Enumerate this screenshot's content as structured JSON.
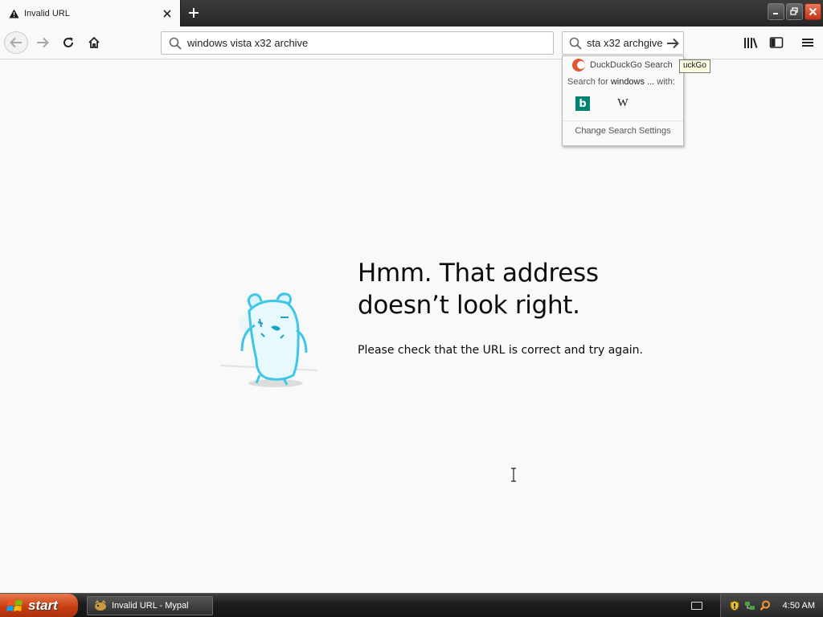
{
  "tab": {
    "title": "Invalid URL",
    "icon": "warning-icon"
  },
  "toolbar": {
    "url_value": "windows vista x32 archive",
    "search_value": "sta x32 archgive"
  },
  "search_popup": {
    "engine_name": "DuckDuckGo Search",
    "search_for_prefix": "Search for",
    "search_for_term": "windows ...",
    "search_for_suffix": "with:",
    "engines": [
      "bing",
      "wikipedia"
    ],
    "settings_label": "Change Search Settings",
    "tooltip": "uckGo"
  },
  "error_page": {
    "title_line1": "Hmm. That address",
    "title_line2": "doesn’t look right.",
    "description": "Please check that the URL is correct and try again."
  },
  "taskbar": {
    "start_label": "start",
    "task_label": "Invalid URL - Mypal",
    "clock": "4:50 AM"
  },
  "colors": {
    "accent_ddg": "#de5833",
    "bing": "#008373",
    "close_button": "#c2351a",
    "start_button": "#c83e13"
  }
}
